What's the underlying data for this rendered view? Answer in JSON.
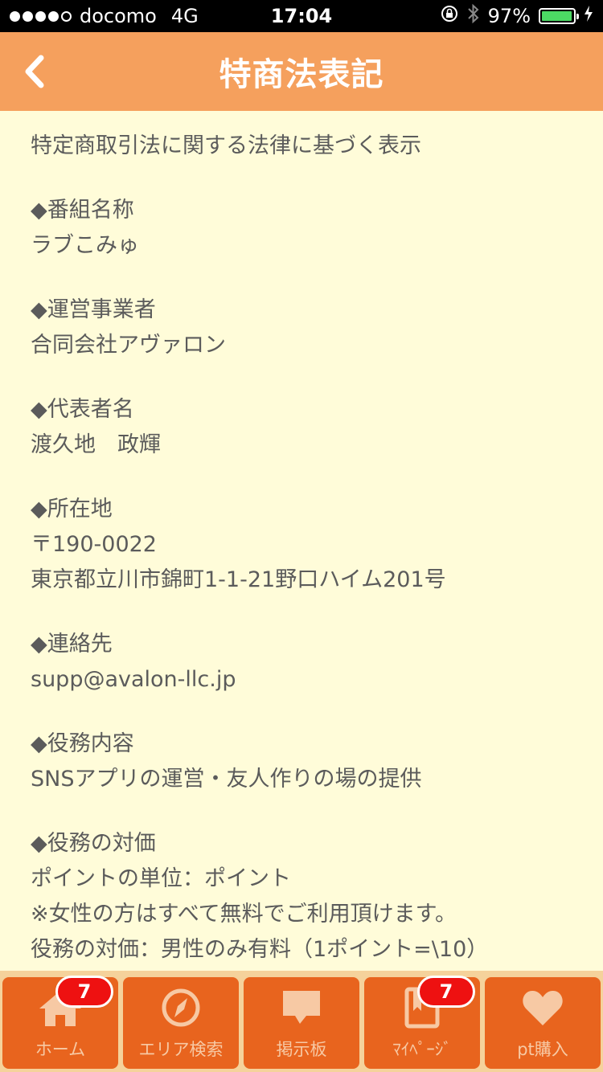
{
  "status_bar": {
    "carrier": "docomo",
    "network": "4G",
    "time": "17:04",
    "battery": "97%"
  },
  "nav": {
    "title": "特商法表記"
  },
  "content": {
    "intro": "特定商取引法に関する法律に基づく表示",
    "sections": [
      {
        "heading": "◆番組名称",
        "lines": [
          "ラブこみゅ"
        ]
      },
      {
        "heading": "◆運営事業者",
        "lines": [
          "合同会社アヴァロン"
        ]
      },
      {
        "heading": "◆代表者名",
        "lines": [
          "渡久地　政輝"
        ]
      },
      {
        "heading": "◆所在地",
        "lines": [
          "〒190-0022",
          "東京都立川市錦町1-1-21野口ハイム201号"
        ]
      },
      {
        "heading": "◆連絡先",
        "lines": [
          "supp@avalon-llc.jp"
        ]
      },
      {
        "heading": "◆役務内容",
        "lines": [
          "SNSアプリの運営・友人作りの場の提供"
        ]
      },
      {
        "heading": "◆役務の対価",
        "lines": [
          "ポイントの単位：ポイント",
          "※女性の方はすべて無料でご利用頂けます。",
          "役務の対価：男性のみ有料（1ポイント=\\10）"
        ]
      }
    ]
  },
  "tab_bar": {
    "tabs": [
      {
        "label": "ホーム",
        "icon": "home-icon",
        "badge": "7"
      },
      {
        "label": "エリア検索",
        "icon": "compass-icon",
        "badge": ""
      },
      {
        "label": "掲示板",
        "icon": "chat-bubble-icon",
        "badge": ""
      },
      {
        "label": "ﾏｲﾍﾟｰｼﾞ",
        "icon": "mypage-book-icon",
        "badge": "7"
      },
      {
        "label": "pt購入",
        "icon": "heart-icon",
        "badge": ""
      }
    ]
  },
  "colors": {
    "nav_bg": "#f5a05d",
    "page_bg": "#fffcd9",
    "tab_bg": "#e8641e",
    "badge_bg": "#ee1111",
    "text": "#5b5b5b"
  }
}
